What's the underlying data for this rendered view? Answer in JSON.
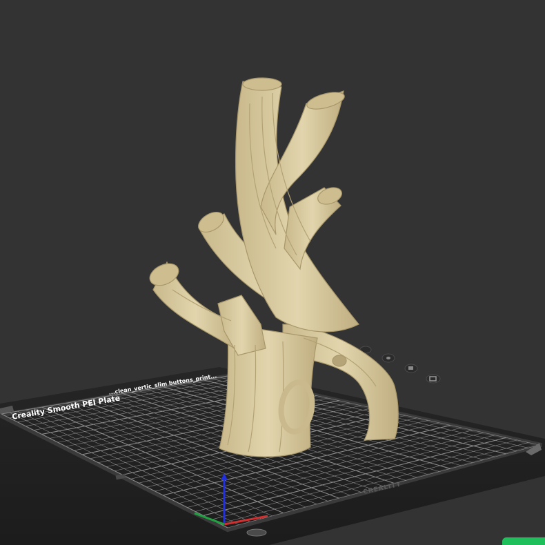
{
  "viewport": {
    "background_color": "#333333",
    "model_color": "#d9cba0"
  },
  "build_plate": {
    "label": "Creality Smooth PEI Plate",
    "object_name": "...clean_vertic_slim buttons_print...",
    "brand": "CREALITY",
    "grid_color": "#8a8a8a",
    "plate_color": "#222222"
  },
  "axes": {
    "x_color": "#d03030",
    "y_color": "#20a040",
    "z_color": "#2030e0"
  },
  "slice_button": {
    "color": "#1fc05c"
  }
}
